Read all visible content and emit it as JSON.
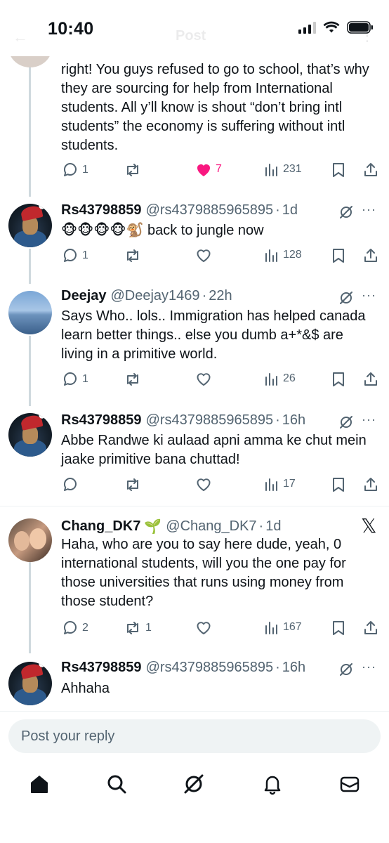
{
  "status_bar": {
    "time": "10:40"
  },
  "header": {
    "title": "Post"
  },
  "tweets": [
    {
      "text": "right! You guys refused to go to school, that’s why they are sourcing for help from International students. All y’ll know is shout “don’t bring intl students” the economy is suffering without intl students.",
      "replies": "1",
      "reposts": "",
      "likes": "7",
      "views": "231"
    },
    {
      "name": "Rs43798859",
      "handle": "@rs4379885965895",
      "time": "1d",
      "text": "🐵🐵🐵🐵🐒 back to jungle now",
      "replies": "1",
      "reposts": "",
      "likes": "",
      "views": "128"
    },
    {
      "name": "Deejay",
      "handle": "@Deejay1469",
      "time": "22h",
      "text": "Says Who.. lols.. Immigration has helped canada learn better things.. else you dumb a+*&$ are living in a primitive world.",
      "replies": "1",
      "reposts": "",
      "likes": "",
      "views": "26"
    },
    {
      "name": "Rs43798859",
      "handle": "@rs4379885965895",
      "time": "16h",
      "text": "Abbe Randwe ki aulaad apni amma ke chut mein jaake primitive bana chuttad!",
      "replies": "",
      "reposts": "",
      "likes": "",
      "views": "17"
    },
    {
      "name": "Chang_DK7",
      "emoji": "🌱",
      "handle": "@Chang_DK7",
      "time": "1d",
      "text": "Haha, who are you to say here dude, yeah, 0 international students, will you the one pay for those universities that runs using money from those student?",
      "replies": "2",
      "reposts": "1",
      "likes": "",
      "views": "167"
    },
    {
      "name": "Rs43798859",
      "handle": "@rs4379885965895",
      "time": "16h",
      "text": "Ahhaha"
    }
  ],
  "reply_box": {
    "placeholder": "Post your reply"
  },
  "icons": {
    "dot": "·",
    "more": "···",
    "x_logo": "𝕏"
  },
  "colors": {
    "like": "#f91880",
    "muted": "#536471",
    "text": "#0f1419",
    "line": "#cfd9de"
  },
  "nav": [
    "home-icon",
    "search-icon",
    "grok-icon",
    "notifications-icon",
    "messages-icon"
  ]
}
